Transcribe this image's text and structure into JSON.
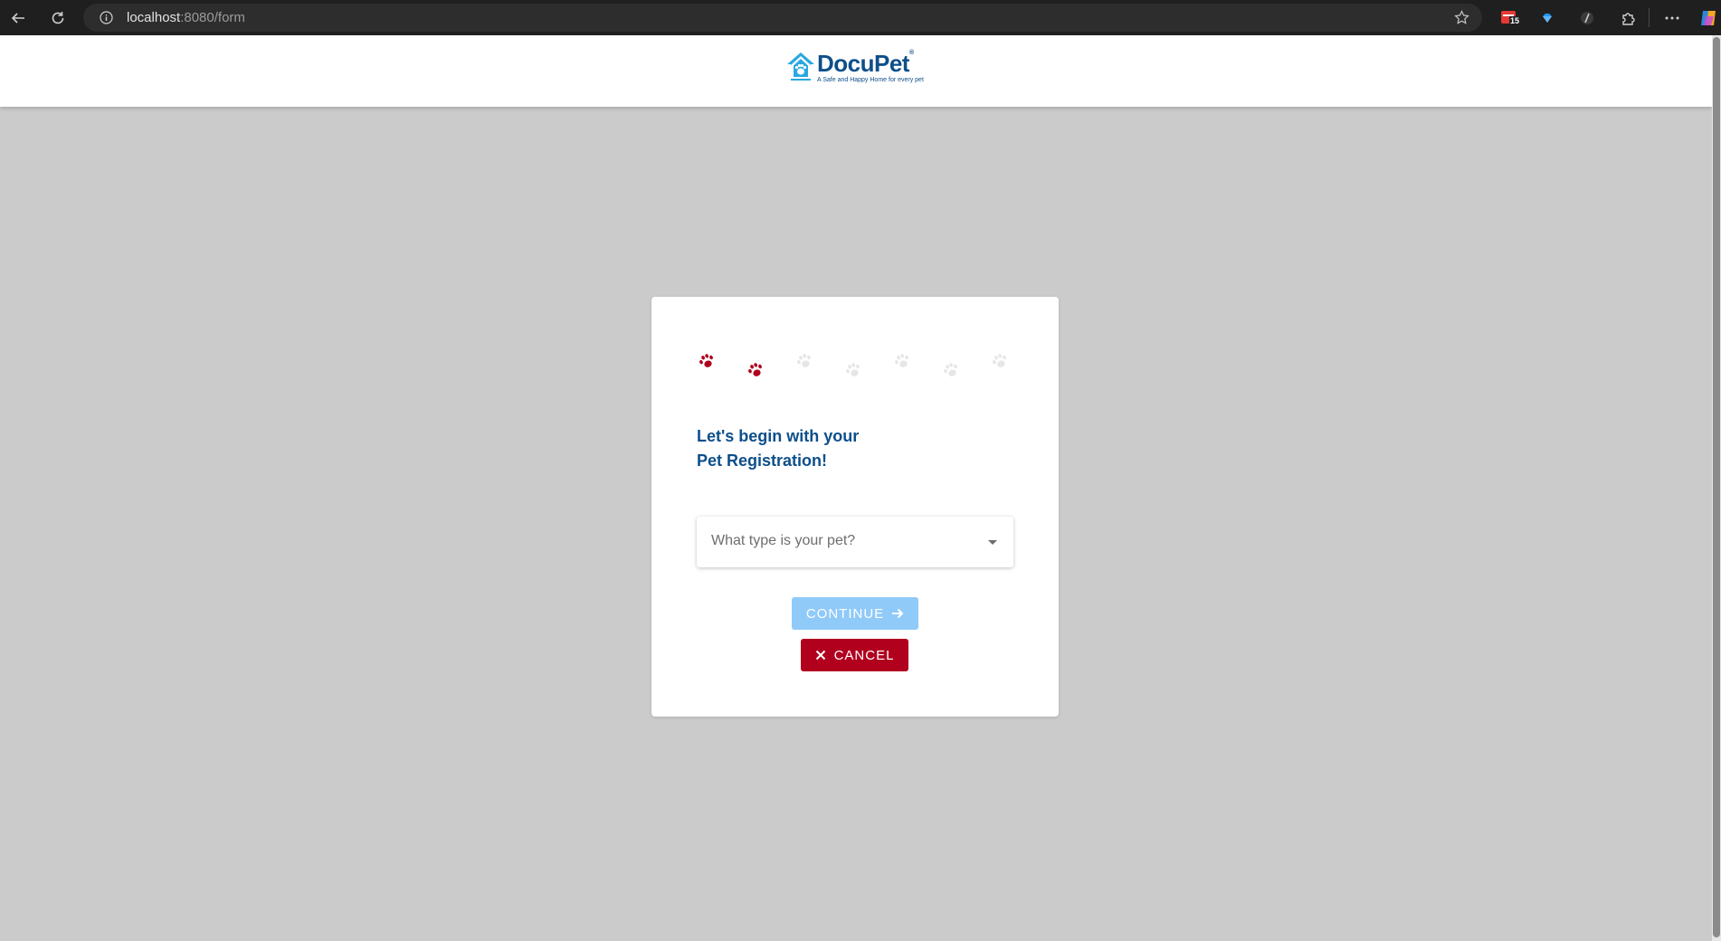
{
  "browser": {
    "url_host": "localhost",
    "url_path": ":8080/form",
    "calendar_badge": "15"
  },
  "header": {
    "brand": "DocuPet",
    "trademark": "®",
    "tagline": "A Safe and Happy Home for every pet"
  },
  "progress": {
    "total_steps": 7,
    "completed_steps": 2,
    "active_color": "#b0001e",
    "inactive_color": "#e6e6e6"
  },
  "form": {
    "heading_line1": "Let's begin with your",
    "heading_line2": "Pet Registration!",
    "pet_type_placeholder": "What type is your pet?",
    "continue_label": "CONTINUE",
    "cancel_label": "CANCEL"
  },
  "colors": {
    "brand_blue": "#0d4f8a",
    "continue_disabled": "#90caf9",
    "cancel_red": "#b0001e",
    "page_bg": "#cbcbcb"
  }
}
